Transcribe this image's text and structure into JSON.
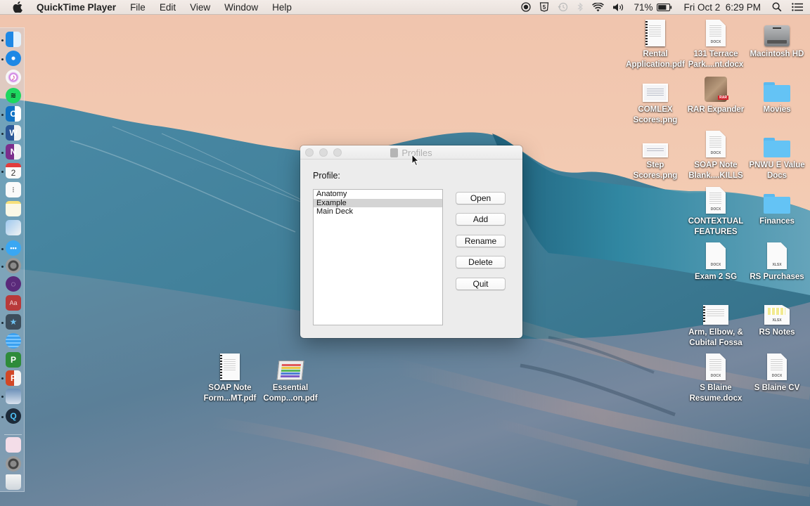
{
  "menubar": {
    "app_name": "QuickTime Player",
    "menus": [
      "File",
      "Edit",
      "View",
      "Window",
      "Help"
    ],
    "status_icons": [
      "record-icon",
      "html5-icon",
      "time-machine-icon",
      "bluetooth-icon",
      "wifi-icon",
      "volume-icon"
    ],
    "battery_percent": "71%",
    "datetime": "Fri Oct 2  6:29 PM"
  },
  "dock": {
    "apps": [
      {
        "name": "finder",
        "running": true
      },
      {
        "name": "safari",
        "running": true
      },
      {
        "name": "itunes",
        "running": false
      },
      {
        "name": "spotify",
        "running": false
      },
      {
        "name": "outlook",
        "running": true
      },
      {
        "name": "word",
        "running": true
      },
      {
        "name": "onenote",
        "running": true
      },
      {
        "name": "calendar",
        "running": true,
        "badge": "2"
      },
      {
        "name": "reminders",
        "running": false
      },
      {
        "name": "notes",
        "running": false
      },
      {
        "name": "preview",
        "running": false
      },
      {
        "name": "messages",
        "running": true
      },
      {
        "name": "system-preferences",
        "running": true
      },
      {
        "name": "bittorrent",
        "running": false
      },
      {
        "name": "dictionary",
        "running": false
      },
      {
        "name": "anki",
        "running": true
      },
      {
        "name": "stack-app",
        "running": false
      },
      {
        "name": "project",
        "running": false
      },
      {
        "name": "powerpoint",
        "running": true
      },
      {
        "name": "image-viewer",
        "running": true
      },
      {
        "name": "quicktime",
        "running": true
      },
      {
        "name": "downloads",
        "running": false
      },
      {
        "name": "system-preferences-2",
        "running": false
      },
      {
        "name": "trash",
        "running": false
      }
    ]
  },
  "desktop": {
    "icons": [
      {
        "label": [
          "Rental",
          "Application.pdf"
        ],
        "kind": "pdf"
      },
      {
        "label": [
          "131 Terrace",
          "Park....nt.docx"
        ],
        "kind": "docx"
      },
      {
        "label": [
          "Macintosh HD"
        ],
        "kind": "hdd"
      },
      {
        "label": [
          "COMLEX",
          "Scores.png"
        ],
        "kind": "png"
      },
      {
        "label": [
          "RAR Expander"
        ],
        "kind": "app"
      },
      {
        "label": [
          "Movies"
        ],
        "kind": "folder"
      },
      {
        "label": [
          "Step",
          "Scores.png"
        ],
        "kind": "png"
      },
      {
        "label": [
          "SOAP Note",
          "Blank....KILLS"
        ],
        "kind": "docx"
      },
      {
        "label": [
          "PNWU E Value",
          "Docs"
        ],
        "kind": "folder"
      },
      {
        "label": [
          "CONTEXTUAL",
          "FEATURES"
        ],
        "kind": "docx"
      },
      {
        "label": [
          "Finances"
        ],
        "kind": "folder"
      },
      {
        "label": [
          "Exam 2 SG"
        ],
        "kind": "docx"
      },
      {
        "label": [
          "RS Purchases"
        ],
        "kind": "xlsx"
      },
      {
        "label": [
          "Arm, Elbow, &",
          "Cubital Fossa"
        ],
        "kind": "pdf"
      },
      {
        "label": [
          "RS Notes"
        ],
        "kind": "xlsx"
      },
      {
        "label": [
          "S Blaine",
          "Resume.docx"
        ],
        "kind": "docx"
      },
      {
        "label": [
          "S Blaine CV"
        ],
        "kind": "docx"
      },
      {
        "label": [
          "SOAP Note",
          "Form...MT.pdf"
        ],
        "kind": "pdf"
      },
      {
        "label": [
          "Essential",
          "Comp...on.pdf"
        ],
        "kind": "pdf"
      }
    ],
    "ext_labels": {
      "docx": "DOCX",
      "xlsx": "XLSX"
    }
  },
  "window": {
    "title": "Profiles",
    "profile_label": "Profile:",
    "profiles": [
      "Anatomy",
      "Example",
      "Main Deck"
    ],
    "selected_profile": "Example",
    "buttons": {
      "open": "Open",
      "add": "Add",
      "rename": "Rename",
      "delete": "Delete",
      "quit": "Quit"
    }
  },
  "colors": {
    "sky": "#f2c9b0",
    "wave": "#3f7f9a",
    "folder": "#64c3f5",
    "selection": "#d4d4d4"
  }
}
